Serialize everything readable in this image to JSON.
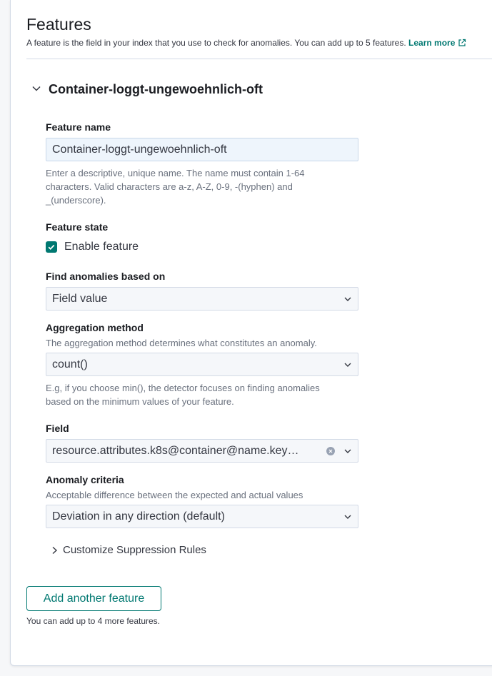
{
  "header": {
    "title": "Features",
    "subtitle": "A feature is the field in your index that you use to check for anomalies. You can add up to 5 features.",
    "learn_more": "Learn more"
  },
  "feature": {
    "accordion_title": "Container-loggt-ungewoehnlich-oft",
    "name_label": "Feature name",
    "name_value": "Container-loggt-ungewoehnlich-oft",
    "name_help": [
      "Enter a descriptive, unique name. The name must contain 1-64",
      "characters. Valid characters are a-z, A-Z, 0-9, -(hyphen) and",
      "_(underscore)."
    ],
    "state_label": "Feature state",
    "enable_label": "Enable feature",
    "enabled": true,
    "find_label": "Find anomalies based on",
    "find_value": "Field value",
    "agg_label": "Aggregation method",
    "agg_help": "The aggregation method determines what constitutes an anomaly.",
    "agg_value": "count()",
    "agg_example": [
      "E.g, if you choose min(), the detector focuses on finding anomalies",
      "based on the minimum values of your feature."
    ],
    "field_label": "Field",
    "field_value": "resource.attributes.k8s@container@name.key…",
    "criteria_label": "Anomaly criteria",
    "criteria_help": "Acceptable difference between the expected and actual values",
    "criteria_value": "Deviation in any direction (default)",
    "suppression_label": "Customize Suppression Rules"
  },
  "footer": {
    "add_button": "Add another feature",
    "add_help": "You can add up to 4 more features."
  },
  "colors": {
    "accent": "#007871",
    "text": "#343741",
    "muted": "#69707d",
    "border": "#d3dae6"
  }
}
